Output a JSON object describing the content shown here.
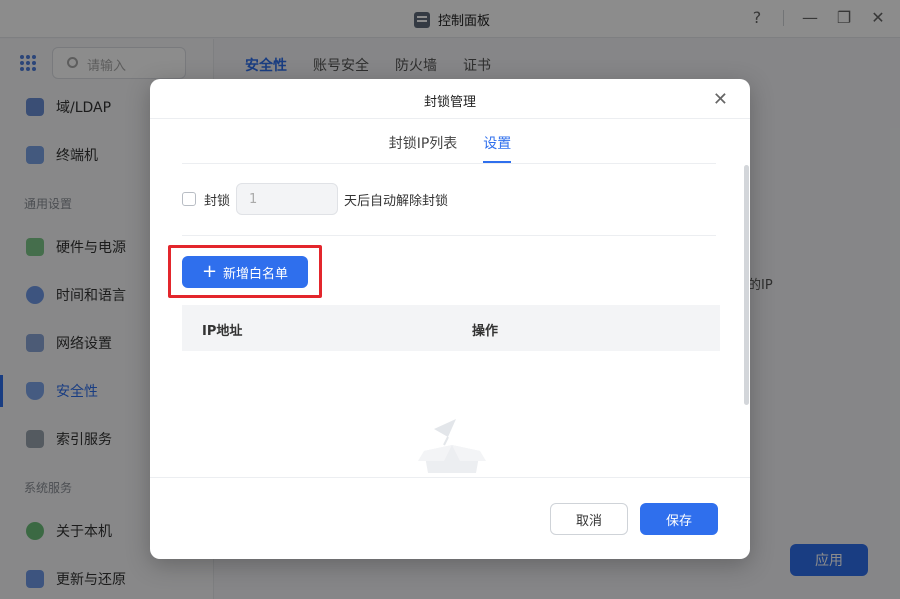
{
  "window": {
    "title": "控制面板",
    "icon": "control-panel-icon",
    "controls": {
      "help": "?",
      "minimize": "—",
      "restore": "❐",
      "close": "✕"
    }
  },
  "sidebar": {
    "search_placeholder": "请输入",
    "items": [
      {
        "label": "域/LDAP",
        "icon": "domain-icon"
      },
      {
        "label": "终端机",
        "icon": "terminal-icon"
      },
      {
        "label": "硬件与电源",
        "icon": "hardware-icon"
      },
      {
        "label": "时间和语言",
        "icon": "clock-icon"
      },
      {
        "label": "网络设置",
        "icon": "network-icon"
      },
      {
        "label": "安全性",
        "icon": "shield-icon"
      },
      {
        "label": "索引服务",
        "icon": "index-icon"
      },
      {
        "label": "关于本机",
        "icon": "info-icon"
      },
      {
        "label": "更新与还原",
        "icon": "refresh-icon"
      }
    ],
    "sections": [
      "通用设置",
      "系统服务"
    ],
    "active": "安全性"
  },
  "main": {
    "tabs": [
      "安全性",
      "账号安全",
      "防火墙",
      "证书"
    ],
    "partial_text": "的IP",
    "apply_label": "应用"
  },
  "dialog": {
    "title": "封锁管理",
    "tabs": [
      {
        "label": "封锁IP列表",
        "active": false
      },
      {
        "label": "设置",
        "active": true
      }
    ],
    "block": {
      "prefix": "封锁",
      "days_value": "1",
      "suffix": "天后自动解除封锁",
      "checked": false
    },
    "add_whitelist_label": "新增白名单",
    "table_headers": [
      "IP地址",
      "操作"
    ],
    "cancel_label": "取消",
    "save_label": "保存"
  },
  "colors": {
    "accent": "#2f6fed",
    "highlight": "#e3262c",
    "overlay": "rgba(0,0,0,0.45)"
  }
}
